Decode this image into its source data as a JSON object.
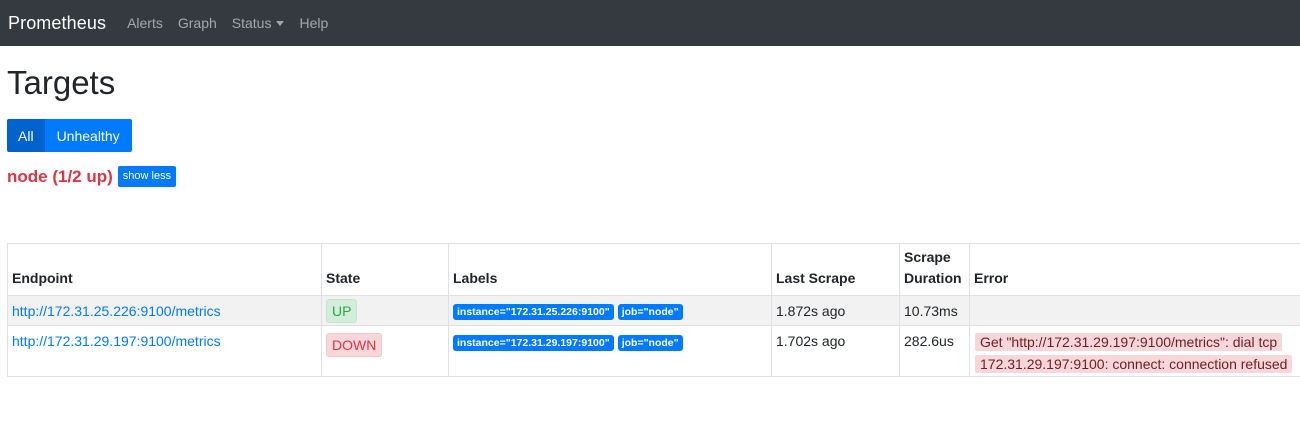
{
  "navbar": {
    "brand": "Prometheus",
    "items": [
      {
        "label": "Alerts"
      },
      {
        "label": "Graph"
      },
      {
        "label": "Status"
      },
      {
        "label": "Help"
      }
    ]
  },
  "page": {
    "title": "Targets",
    "filter_all": "All",
    "filter_unhealthy": "Unhealthy",
    "active_filter": "All"
  },
  "pool": {
    "title": "node (1/2 up)",
    "toggle_label": "show less"
  },
  "table": {
    "headers": {
      "endpoint": "Endpoint",
      "state": "State",
      "labels": "Labels",
      "last_scrape": "Last Scrape",
      "scrape_duration": "Scrape Duration",
      "error": "Error"
    },
    "rows": [
      {
        "endpoint": "http://172.31.25.226:9100/metrics",
        "state": "UP",
        "label_instance": "instance=\"172.31.25.226:9100\"",
        "label_job": "job=\"node\"",
        "last_scrape": "1.872s ago",
        "scrape_duration": "10.73ms",
        "error": ""
      },
      {
        "endpoint": "http://172.31.29.197:9100/metrics",
        "state": "DOWN",
        "label_instance": "instance=\"172.31.29.197:9100\"",
        "label_job": "job=\"node\"",
        "last_scrape": "1.702s ago",
        "scrape_duration": "282.6us",
        "error": "Get \"http://172.31.29.197:9100/metrics\": dial tcp 172.31.29.197:9100: connect: connection refused"
      }
    ]
  },
  "colors": {
    "navbar_bg": "#343a40",
    "primary": "#007bff",
    "primary_active": "#0062cc",
    "danger": "#dc3545",
    "success": "#28a745"
  }
}
